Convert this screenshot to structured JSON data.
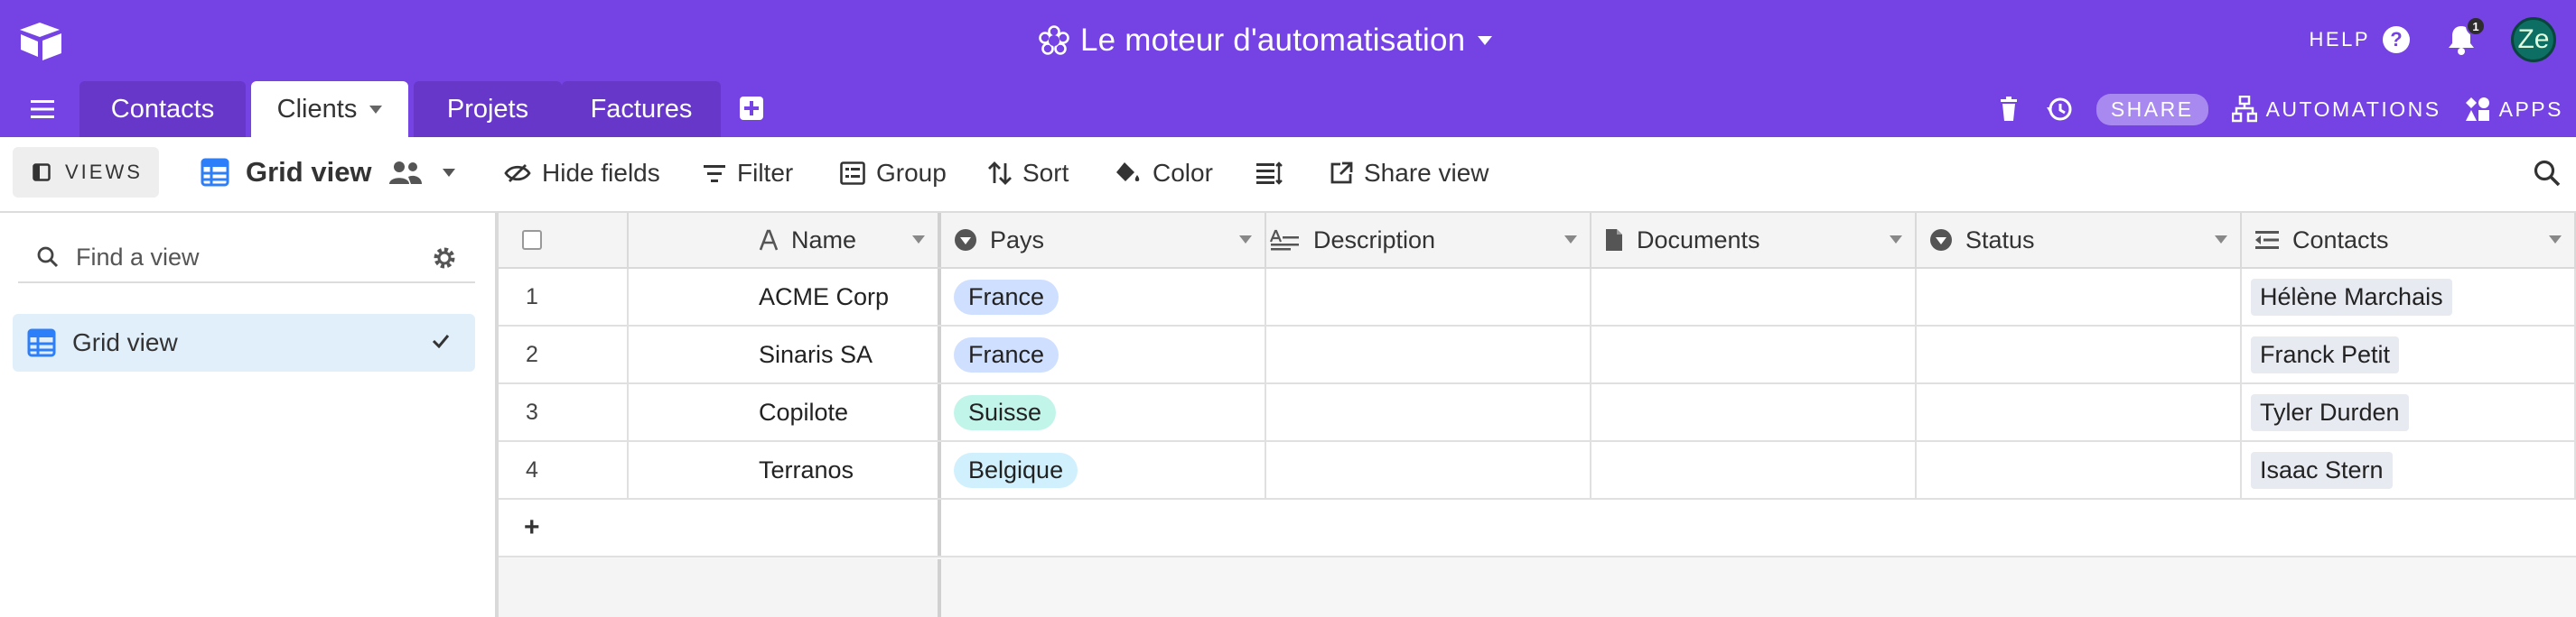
{
  "app": {
    "base_title": "Le moteur d'automatisation",
    "help_label": "HELP",
    "help_icon": "?",
    "notification_count": "1",
    "avatar_initials": "Ze",
    "colors": {
      "brand": "#7542E3",
      "tab_inactive": "#6637C8"
    }
  },
  "tabs": [
    {
      "label": "Contacts",
      "active": false
    },
    {
      "label": "Clients",
      "active": true
    },
    {
      "label": "Projets",
      "active": false
    },
    {
      "label": "Factures",
      "active": false
    }
  ],
  "tabbar_right": {
    "share_label": "SHARE",
    "automations_label": "AUTOMATIONS",
    "apps_label": "APPS"
  },
  "toolbar": {
    "views_label": "VIEWS",
    "current_view": "Grid view",
    "hide_fields": "Hide fields",
    "filter": "Filter",
    "group": "Group",
    "sort": "Sort",
    "color": "Color",
    "share_view": "Share view"
  },
  "sidebar": {
    "search_placeholder": "Find a view",
    "views": [
      {
        "label": "Grid view",
        "selected": true
      }
    ]
  },
  "grid": {
    "columns": [
      {
        "label": "Name",
        "icon": "text-a-icon"
      },
      {
        "label": "Pays",
        "icon": "single-select-icon"
      },
      {
        "label": "Description",
        "icon": "long-text-icon"
      },
      {
        "label": "Documents",
        "icon": "attachment-icon"
      },
      {
        "label": "Status",
        "icon": "single-select-icon"
      },
      {
        "label": "Contacts",
        "icon": "linked-record-icon"
      }
    ],
    "rows": [
      {
        "num": "1",
        "name": "ACME Corp",
        "pays": "France",
        "pays_color": "#cfdfff",
        "contact": "Hélène Marchais"
      },
      {
        "num": "2",
        "name": "Sinaris SA",
        "pays": "France",
        "pays_color": "#cfdfff",
        "contact": "Franck Petit"
      },
      {
        "num": "3",
        "name": "Copilote",
        "pays": "Suisse",
        "pays_color": "#c2f5e9",
        "contact": "Tyler Durden"
      },
      {
        "num": "4",
        "name": "Terranos",
        "pays": "Belgique",
        "pays_color": "#d0f0fd",
        "contact": "Isaac Stern"
      }
    ],
    "add_row_symbol": "+"
  }
}
